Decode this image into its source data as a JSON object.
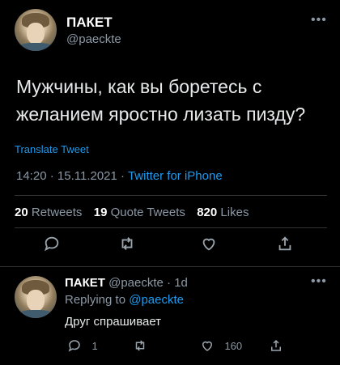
{
  "tweet": {
    "author_name": "ПАКЕТ",
    "author_handle": "@paeckte",
    "text": "Мужчины, как вы боретесь с желанием яростно лизать пизду?",
    "translate_label": "Translate Tweet",
    "time": "14:20",
    "date": "15.11.2021",
    "source": "Twitter for iPhone",
    "stats": {
      "retweets_count": "20",
      "retweets_label": "Retweets",
      "quote_count": "19",
      "quote_label": "Quote Tweets",
      "likes_count": "820",
      "likes_label": "Likes"
    },
    "actions": {
      "reply_icon": "reply-icon",
      "retweet_icon": "retweet-icon",
      "like_icon": "heart-icon",
      "share_icon": "share-icon"
    }
  },
  "reply": {
    "author_name": "ПАКЕТ",
    "author_handle": "@paeckte",
    "time_ago": "1d",
    "replying_to_label": "Replying to",
    "replying_to_handle": "@paeckte",
    "text": "Друг спрашивает",
    "reply_count": "1",
    "like_count": "160"
  },
  "colors": {
    "background": "#000000",
    "accent": "#1d9bf0",
    "muted": "#8b98a5",
    "divider": "#2f3336"
  }
}
